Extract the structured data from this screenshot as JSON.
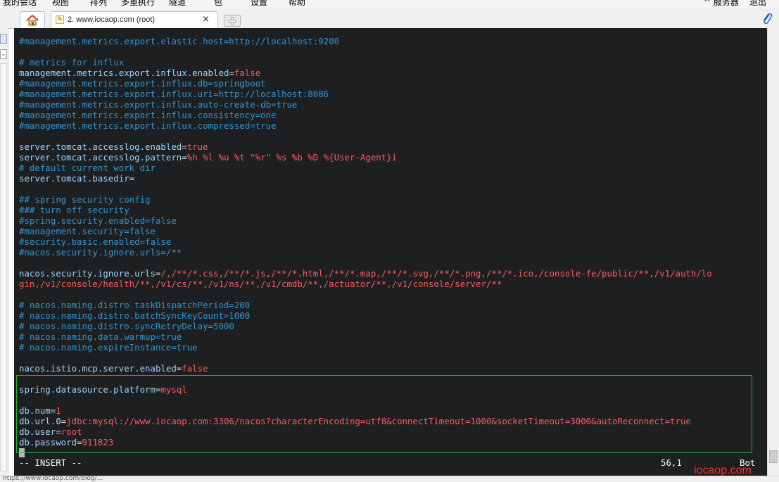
{
  "menubar": {
    "items": [
      "我的会话",
      "视图",
      "排列",
      "多重执行",
      "隧道",
      "包",
      "设置",
      "帮助"
    ],
    "right_items": [
      "^ 服务器",
      "退出"
    ]
  },
  "tabs": {
    "home_icon": "home-icon",
    "session_label": "2. www.iocaop.com (root)",
    "close_glyph": "×",
    "new_tab_icon": "plus-icon",
    "attach_icon": "paperclip-icon"
  },
  "terminal": {
    "lines": [
      [
        {
          "t": "#management.metrics.export.elastic.host=http://localhost:9200",
          "c": "c"
        }
      ],
      [],
      [
        {
          "t": "# metrics for influx",
          "c": "c"
        }
      ],
      [
        {
          "t": "management.metrics.export.influx.enabled",
          "c": "k"
        },
        {
          "t": "=",
          "c": "p"
        },
        {
          "t": "false",
          "c": "v"
        }
      ],
      [
        {
          "t": "#management.metrics.export.influx.db=springboot",
          "c": "c"
        }
      ],
      [
        {
          "t": "#management.metrics.export.influx.uri=http://localhost:8086",
          "c": "c"
        }
      ],
      [
        {
          "t": "#management.metrics.export.influx.auto-create-db=true",
          "c": "c"
        }
      ],
      [
        {
          "t": "#management.metrics.export.influx.consistency=one",
          "c": "c"
        }
      ],
      [
        {
          "t": "#management.metrics.export.influx.compressed=true",
          "c": "c"
        }
      ],
      [],
      [
        {
          "t": "server.tomcat.accesslog.enabled",
          "c": "k"
        },
        {
          "t": "=",
          "c": "p"
        },
        {
          "t": "true",
          "c": "v"
        }
      ],
      [
        {
          "t": "server.tomcat.accesslog.pattern",
          "c": "k"
        },
        {
          "t": "=",
          "c": "p"
        },
        {
          "t": "%h %l %u %t \"%r\" %s %b %D %{User-Agent}i",
          "c": "v"
        }
      ],
      [
        {
          "t": "# default current work dir",
          "c": "c"
        }
      ],
      [
        {
          "t": "server.tomcat.basedir",
          "c": "k"
        },
        {
          "t": "=",
          "c": "p"
        }
      ],
      [],
      [
        {
          "t": "## spring security config",
          "c": "c"
        }
      ],
      [
        {
          "t": "### turn off security",
          "c": "c"
        }
      ],
      [
        {
          "t": "#spring.security.enabled=false",
          "c": "c"
        }
      ],
      [
        {
          "t": "#management.security=false",
          "c": "c"
        }
      ],
      [
        {
          "t": "#security.basic.enabled=false",
          "c": "c"
        }
      ],
      [
        {
          "t": "#nacos.security.ignore.urls=/**",
          "c": "c"
        }
      ],
      [],
      [
        {
          "t": "nacos.security.ignore.urls",
          "c": "k"
        },
        {
          "t": "=",
          "c": "p"
        },
        {
          "t": "/,/**/*.css,/**/*.js,/**/*.html,/**/*.map,/**/*.svg,/**/*.png,/**/*.ico,/console-fe/public/**,/v1/auth/lo",
          "c": "v"
        }
      ],
      [
        {
          "t": "gin,/v1/console/health/**,/v1/cs/**,/v1/ns/**,/v1/cmdb/**,/actuator/**,/v1/console/server/**",
          "c": "v"
        }
      ],
      [],
      [
        {
          "t": "# nacos.naming.distro.taskDispatchPeriod=200",
          "c": "c"
        }
      ],
      [
        {
          "t": "# nacos.naming.distro.batchSyncKeyCount=1000",
          "c": "c"
        }
      ],
      [
        {
          "t": "# nacos.naming.distro.syncRetryDelay=5000",
          "c": "c"
        }
      ],
      [
        {
          "t": "# nacos.naming.data.warmup=true",
          "c": "c"
        }
      ],
      [
        {
          "t": "# nacos.naming.expireInstance=true",
          "c": "c"
        }
      ],
      [],
      [
        {
          "t": "nacos.istio.mcp.server.enabled",
          "c": "k"
        },
        {
          "t": "=",
          "c": "p"
        },
        {
          "t": "false",
          "c": "v"
        }
      ],
      [],
      [
        {
          "t": "spring.datasource.platform",
          "c": "k"
        },
        {
          "t": "=",
          "c": "p"
        },
        {
          "t": "mysql",
          "c": "v"
        }
      ],
      [],
      [
        {
          "t": "db.num",
          "c": "k"
        },
        {
          "t": "=",
          "c": "p"
        },
        {
          "t": "1",
          "c": "v"
        }
      ],
      [
        {
          "t": "db.url.0",
          "c": "k"
        },
        {
          "t": "=",
          "c": "p"
        },
        {
          "t": "jdbc:mysql://www.iocaop.com:3306/nacos?characterEncoding=utf8&connectTimeout=1000&socketTimeout=3000&autoReconnect=true",
          "c": "v"
        }
      ],
      [
        {
          "t": "db.user",
          "c": "k"
        },
        {
          "t": "=",
          "c": "p"
        },
        {
          "t": "root",
          "c": "v"
        }
      ],
      [
        {
          "t": "db.password",
          "c": "k"
        },
        {
          "t": "=",
          "c": "p"
        },
        {
          "t": "911823",
          "c": "v"
        }
      ],
      [
        {
          "cursor": true
        }
      ]
    ],
    "mode": "-- INSERT --",
    "position": "56,1",
    "scroll": "Bot",
    "colors": {
      "background": "#1d1f21",
      "key": "#9ad4ff",
      "value": "#ff5b5b",
      "comment": "#2f96d6",
      "highlight_border": "#27b33a"
    }
  },
  "watermark": "iocaop.com",
  "footer": {
    "url_text": "https://www.iocaop.com/blog/..."
  }
}
